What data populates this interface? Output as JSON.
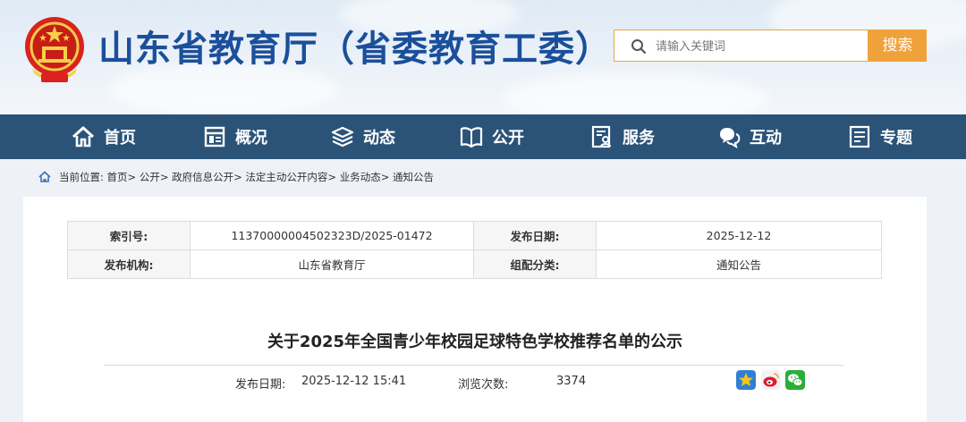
{
  "site": {
    "title": "山东省教育厅（省委教育工委）",
    "search_placeholder": "请输入关键词",
    "search_button": "搜索"
  },
  "nav": {
    "items": [
      {
        "label": "首页",
        "icon": "home-icon"
      },
      {
        "label": "概况",
        "icon": "overview-icon"
      },
      {
        "label": "动态",
        "icon": "stack-icon"
      },
      {
        "label": "公开",
        "icon": "book-icon"
      },
      {
        "label": "服务",
        "icon": "service-icon"
      },
      {
        "label": "互动",
        "icon": "chat-icon"
      },
      {
        "label": "专题",
        "icon": "topic-icon"
      }
    ]
  },
  "breadcrumb": {
    "text": "当前位置: 首页> 公开> 政府信息公开> 法定主动公开内容> 业务动态> 通知公告"
  },
  "meta": {
    "index_label": "索引号:",
    "index_value": "11370000004502323D/2025-01472",
    "date_label": "发布日期:",
    "date_value": "2025-12-12",
    "org_label": "发布机构:",
    "org_value": "山东省教育厅",
    "category_label": "组配分类:",
    "category_value": "通知公告"
  },
  "article": {
    "title": "关于2025年全国青少年校园足球特色学校推荐名单的公示",
    "pub_label": "发布日期:",
    "pub_value": "2025-12-12 15:41",
    "views_label": "浏览次数:",
    "views_value": "3374"
  },
  "share": [
    "qzone-icon",
    "weibo-icon",
    "wechat-icon"
  ],
  "colors": {
    "title_blue": "#1b4f9b",
    "nav_bg": "#2b5378",
    "search_orange": "#f0a23a"
  }
}
